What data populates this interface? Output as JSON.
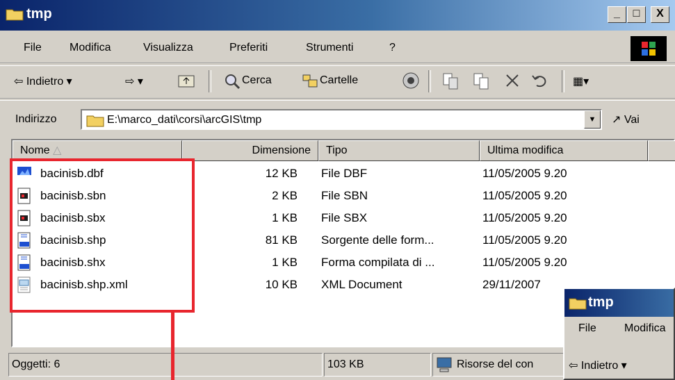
{
  "window": {
    "title": "tmp"
  },
  "titlebar_buttons": {
    "minimize": "_",
    "maximize": "□",
    "close": "X"
  },
  "menu": [
    "File",
    "Modifica",
    "Visualizza",
    "Preferiti",
    "Strumenti",
    "?"
  ],
  "toolbar": {
    "back": "⇦ Indietro ▾",
    "forward": "⇨ ▾",
    "search": "Cerca",
    "folders": "Cartelle",
    "views": "▦▾"
  },
  "address": {
    "label": "Indirizzo",
    "value": "E:\\marco_dati\\corsi\\arcGIS\\tmp",
    "go": "Vai"
  },
  "columns": {
    "name": "Nome",
    "size": "Dimensione",
    "type": "Tipo",
    "modified": "Ultima modifica"
  },
  "files": [
    {
      "name": "bacinisb.dbf",
      "size": "12 KB",
      "type": "File DBF",
      "modified": "11/05/2005 9.20",
      "icon": "dbf-icon"
    },
    {
      "name": "bacinisb.sbn",
      "size": "2 KB",
      "type": "File SBN",
      "modified": "11/05/2005 9.20",
      "icon": "sbn-icon"
    },
    {
      "name": "bacinisb.sbx",
      "size": "1 KB",
      "type": "File SBX",
      "modified": "11/05/2005 9.20",
      "icon": "sbx-icon"
    },
    {
      "name": "bacinisb.shp",
      "size": "81 KB",
      "type": "Sorgente delle form...",
      "modified": "11/05/2005 9.20",
      "icon": "shp-icon"
    },
    {
      "name": "bacinisb.shx",
      "size": "1 KB",
      "type": "Forma compilata di ...",
      "modified": "11/05/2005 9.20",
      "icon": "shx-icon"
    },
    {
      "name": "bacinisb.shp.xml",
      "size": "10 KB",
      "type": "XML Document",
      "modified": "29/11/2007",
      "icon": "xml-icon"
    }
  ],
  "status": {
    "objects": "Oggetti: 6",
    "size": "103 KB",
    "location": "Risorse del con"
  },
  "window2": {
    "title": "tmp",
    "menu": [
      "File",
      "Modifica"
    ],
    "back": "⇦ Indietro ▾"
  },
  "colors": {
    "highlight": "#e8262e",
    "titlebar": "#0a246a"
  }
}
